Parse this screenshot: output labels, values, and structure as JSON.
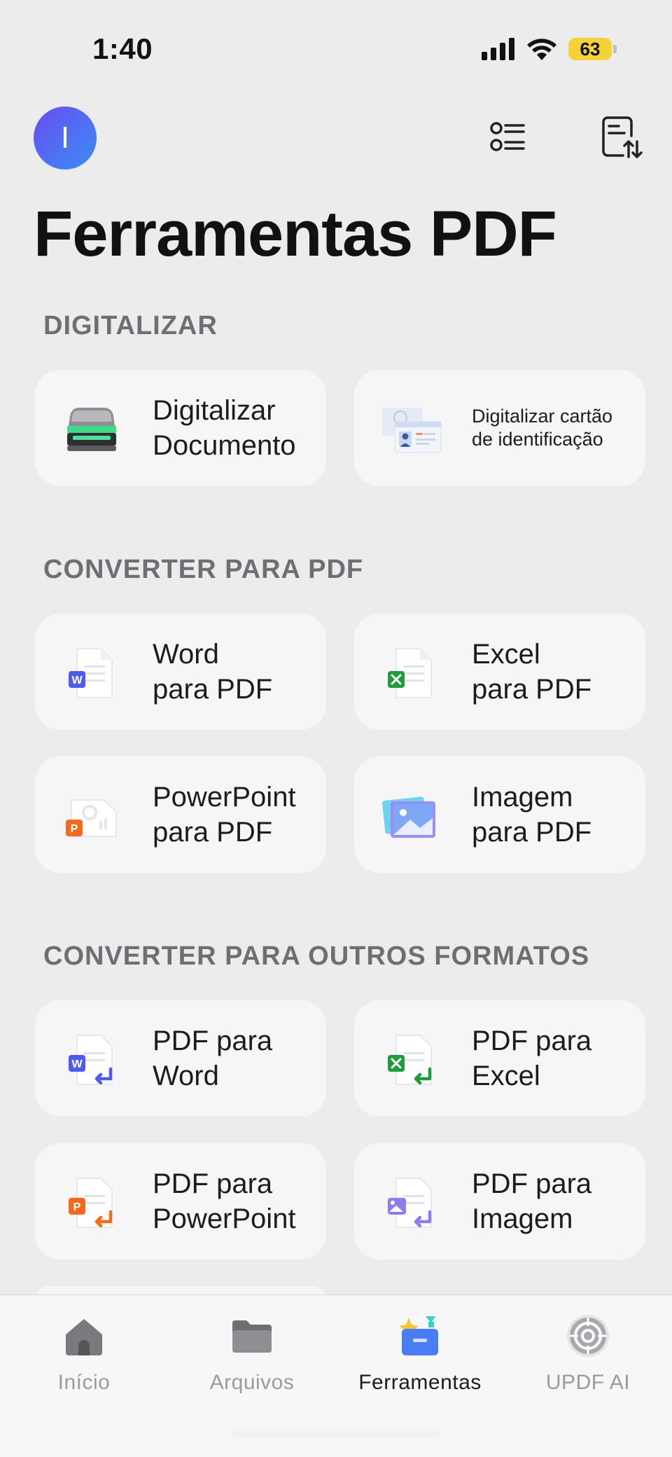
{
  "status": {
    "time": "1:40",
    "battery": "63"
  },
  "header": {
    "avatar_initial": "I",
    "title": "Ferramentas PDF"
  },
  "sections": {
    "scan": {
      "label": "DIGITALIZAR",
      "items": [
        {
          "label": "Digitalizar\nDocumento",
          "icon": "scanner-icon"
        },
        {
          "label": "Digitalizar cartão\nde identificação",
          "icon": "id-card-icon"
        }
      ]
    },
    "to_pdf": {
      "label": "CONVERTER PARA PDF",
      "items": [
        {
          "label": "Word\npara PDF",
          "icon": "word-doc-icon"
        },
        {
          "label": "Excel\npara PDF",
          "icon": "excel-doc-icon"
        },
        {
          "label": "PowerPoint\npara PDF",
          "icon": "powerpoint-doc-icon"
        },
        {
          "label": "Imagem\npara PDF",
          "icon": "image-stack-icon"
        }
      ]
    },
    "from_pdf": {
      "label": "CONVERTER PARA OUTROS FORMATOS",
      "items": [
        {
          "label": "PDF para\nWord",
          "icon": "pdf-to-word-icon"
        },
        {
          "label": "PDF para\nExcel",
          "icon": "pdf-to-excel-icon"
        },
        {
          "label": "PDF para\nPowerPoint",
          "icon": "pdf-to-powerpoint-icon"
        },
        {
          "label": "PDF para\nImagem",
          "icon": "pdf-to-image-icon"
        }
      ]
    }
  },
  "tabs": [
    {
      "label": "Início",
      "icon": "home-icon",
      "active": false
    },
    {
      "label": "Arquivos",
      "icon": "folder-icon",
      "active": false
    },
    {
      "label": "Ferramentas",
      "icon": "toolbox-icon",
      "active": true
    },
    {
      "label": "UPDF AI",
      "icon": "ai-logo-icon",
      "active": false
    }
  ],
  "colors": {
    "word": "#4f5bf0",
    "excel": "#1f9d3c",
    "powerpoint": "#f26a1b",
    "image": "#8c7cf0",
    "accent": "#4a7cf5"
  }
}
